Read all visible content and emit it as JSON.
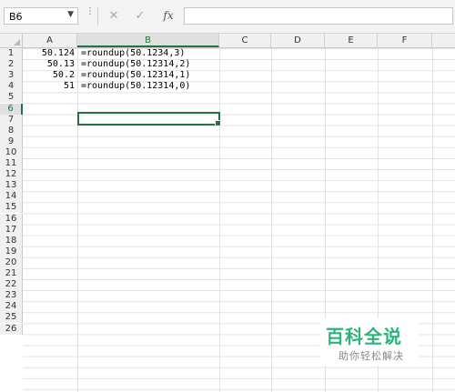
{
  "formula_bar": {
    "name_box": "B6",
    "name_box_arrow": "▼",
    "dots": "⋮",
    "cancel_icon": "✕",
    "enter_icon": "✓",
    "fx_label": "fx",
    "formula": ""
  },
  "columns": [
    "A",
    "B",
    "C",
    "D",
    "E",
    "F"
  ],
  "rows": [
    "1",
    "2",
    "3",
    "4",
    "5",
    "6",
    "7",
    "8",
    "9",
    "10",
    "11",
    "12",
    "13",
    "14",
    "15",
    "16",
    "17",
    "18",
    "19",
    "20",
    "21",
    "22",
    "23",
    "24",
    "25",
    "26"
  ],
  "active": {
    "column": "B",
    "row": "6"
  },
  "cells": {
    "A1": "50.124",
    "B1": "=roundup(50.1234,3)",
    "A2": "50.13",
    "B2": "=roundup(50.12314,2)",
    "A3": "50.2",
    "B3": "=roundup(50.12314,1)",
    "A4": "51",
    "B4": "=roundup(50.12314,0)"
  },
  "watermark": {
    "title": "百科全说",
    "subtitle": "助你轻松解决"
  },
  "colors": {
    "accent": "#217346",
    "watermark": "#2fb37a"
  }
}
